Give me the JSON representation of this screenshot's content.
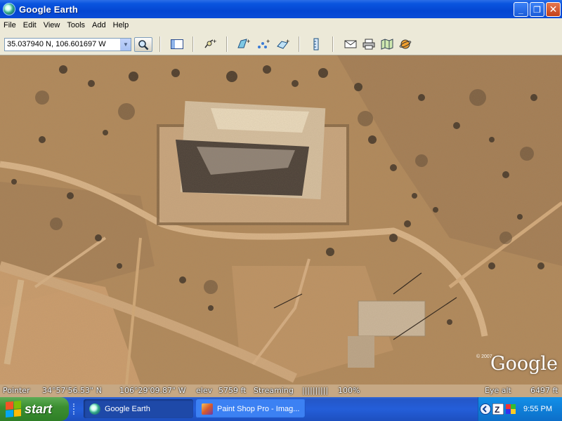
{
  "window": {
    "title": "Google Earth",
    "buttons": {
      "minimize": "_",
      "maximize": "❐",
      "close": "✕"
    }
  },
  "menu": [
    "File",
    "Edit",
    "View",
    "Tools",
    "Add",
    "Help"
  ],
  "toolbar": {
    "search_value": "35.037940 N, 106.601697 W",
    "dropdown_glyph": "▼"
  },
  "map": {
    "logo": "Google",
    "copyright": "© 2007"
  },
  "status": {
    "pointer_label": "Pointer",
    "lat": "34°57'56.53\" N",
    "lon": "106°29'09.87\" W",
    "elev_label": "elev",
    "elev_value": "5759 ft",
    "streaming_label": "Streaming",
    "streaming_bar": "||||||||||",
    "streaming_pct": "100%",
    "eye_alt_label": "Eye alt",
    "eye_alt_value": "6497 ft"
  },
  "taskbar": {
    "start_label": "start",
    "tasks": [
      {
        "label": "Google Earth"
      },
      {
        "label": "Paint Shop Pro - Imag..."
      }
    ],
    "clock": "9:55 PM"
  },
  "colors": {
    "titlebar": "#0a55df",
    "menubar": "#ece9d8",
    "taskbar": "#245ed9",
    "start": "#3c8f31",
    "terrain": "#b58a5e"
  }
}
